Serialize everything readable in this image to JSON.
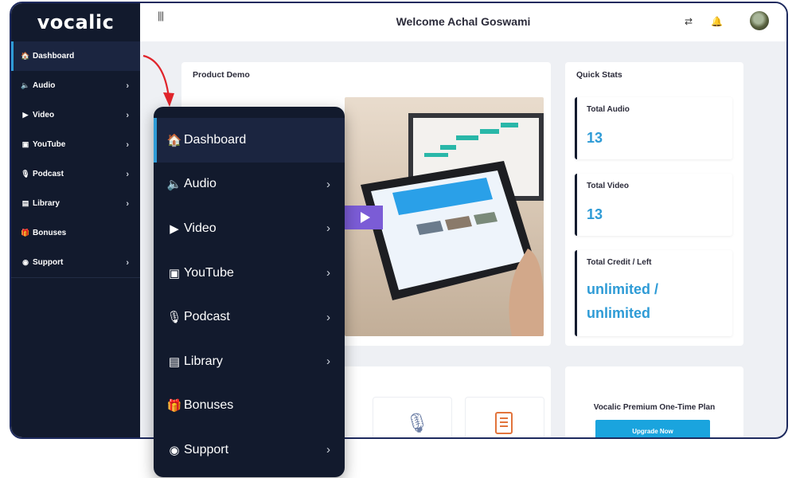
{
  "app": {
    "logo": "vocalic",
    "welcome": "Welcome Achal Goswami"
  },
  "sidebar": {
    "items": [
      {
        "label": "Dashboard",
        "icon": "home-icon",
        "glyph": "🏠",
        "chevron": ""
      },
      {
        "label": "Audio",
        "icon": "speaker-icon",
        "glyph": "🔈",
        "chevron": "›"
      },
      {
        "label": "Video",
        "icon": "play-icon",
        "glyph": "▶",
        "chevron": "›"
      },
      {
        "label": "YouTube",
        "icon": "youtube-icon",
        "glyph": "▣",
        "chevron": "›"
      },
      {
        "label": "Podcast",
        "icon": "microphone-icon",
        "glyph": "🎙",
        "chevron": "›"
      },
      {
        "label": "Library",
        "icon": "book-icon",
        "glyph": "▤",
        "chevron": "›"
      },
      {
        "label": "Bonuses",
        "icon": "gift-icon",
        "glyph": "🎁",
        "chevron": ""
      },
      {
        "label": "Support",
        "icon": "eye-icon",
        "glyph": "◉",
        "chevron": "›"
      }
    ]
  },
  "product_demo": {
    "title": "Product Demo"
  },
  "quick_stats": {
    "title": "Quick Stats",
    "total_audio": {
      "label": "Total Audio",
      "value": "13"
    },
    "total_video": {
      "label": "Total Video",
      "value": "13"
    },
    "total_credit": {
      "label": "Total Credit / Left",
      "value_line1": "unlimited /",
      "value_line2": "unlimited"
    }
  },
  "premium": {
    "title": "Vocalic Premium One-Time Plan",
    "button": "Upgrade Now"
  },
  "colors": {
    "sidebar_bg": "#121a2d",
    "accent": "#2e9bd6",
    "frame_border": "#1e2a5e",
    "button": "#1aa4de"
  }
}
